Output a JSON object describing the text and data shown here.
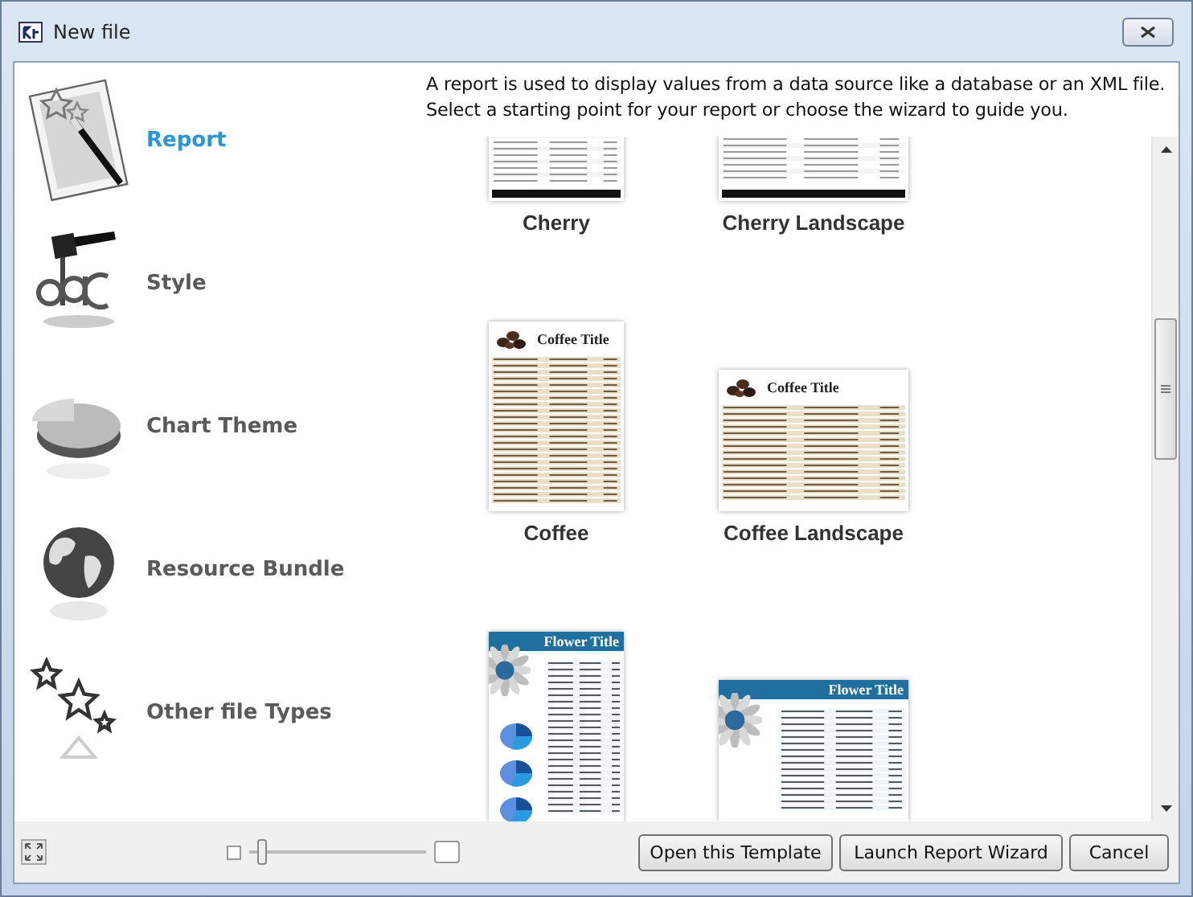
{
  "window": {
    "title": "New file"
  },
  "sidebar": {
    "items": [
      {
        "kind": "report",
        "label": "Report",
        "selected": true
      },
      {
        "kind": "style",
        "label": "Style",
        "selected": false
      },
      {
        "kind": "chart",
        "label": "Chart Theme",
        "selected": false
      },
      {
        "kind": "bundle",
        "label": "Resource Bundle",
        "selected": false
      },
      {
        "kind": "other",
        "label": "Other file Types",
        "selected": false
      }
    ]
  },
  "description": "A report is used to display values from a data source like a database or an XML file.\nSelect a starting point for your report or choose the wizard to guide you.",
  "templates": [
    {
      "kind": "cherry",
      "landscape": false,
      "name": "Cherry"
    },
    {
      "kind": "cherry",
      "landscape": true,
      "name": "Cherry Landscape"
    },
    {
      "kind": "coffee",
      "landscape": false,
      "title": "Coffee Title",
      "name": "Coffee"
    },
    {
      "kind": "coffee",
      "landscape": true,
      "title": "Coffee Title",
      "name": "Coffee Landscape"
    },
    {
      "kind": "flower",
      "landscape": false,
      "title": "Flower Title"
    },
    {
      "kind": "flower",
      "landscape": true,
      "title": "Flower Title"
    }
  ],
  "zoom_slider": {
    "level": 0.07
  },
  "buttons": [
    "Open this Template",
    "Launch Report Wizard",
    "Cancel"
  ]
}
